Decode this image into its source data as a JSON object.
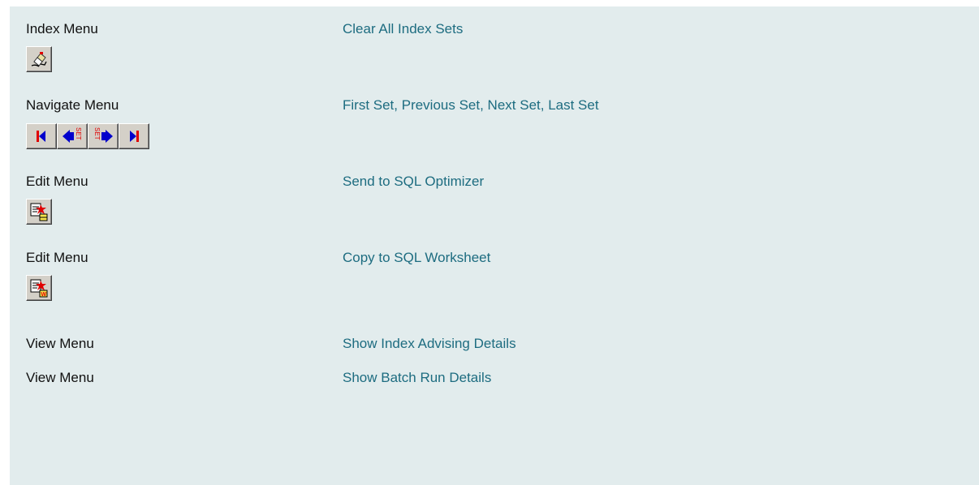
{
  "rows": [
    {
      "menu": "Index Menu",
      "command": "Clear All Index Sets",
      "icons": [
        "eraser-icon"
      ]
    },
    {
      "menu": "Navigate Menu",
      "command": "First Set, Previous Set, Next Set, Last Set",
      "icons": [
        "first-set-icon",
        "previous-set-icon",
        "next-set-icon",
        "last-set-icon"
      ]
    },
    {
      "menu": "Edit Menu",
      "command": "Send to SQL Optimizer",
      "icons": [
        "send-to-optimizer-icon"
      ]
    },
    {
      "menu": "Edit Menu",
      "command": "Copy to SQL Worksheet",
      "icons": [
        "copy-to-worksheet-icon"
      ]
    },
    {
      "menu": "View Menu",
      "command": "Show Index Advising Details",
      "icons": []
    },
    {
      "menu": "View Menu",
      "command": "Show Batch Run Details",
      "icons": []
    }
  ],
  "set_glyph": "SET",
  "worksheet_glyph": "W",
  "colors": {
    "panel_background": "#e2eced",
    "command_link": "#1d6c80",
    "nav_arrow_blue": "#0000cc",
    "nav_accent_red": "#e00000"
  }
}
